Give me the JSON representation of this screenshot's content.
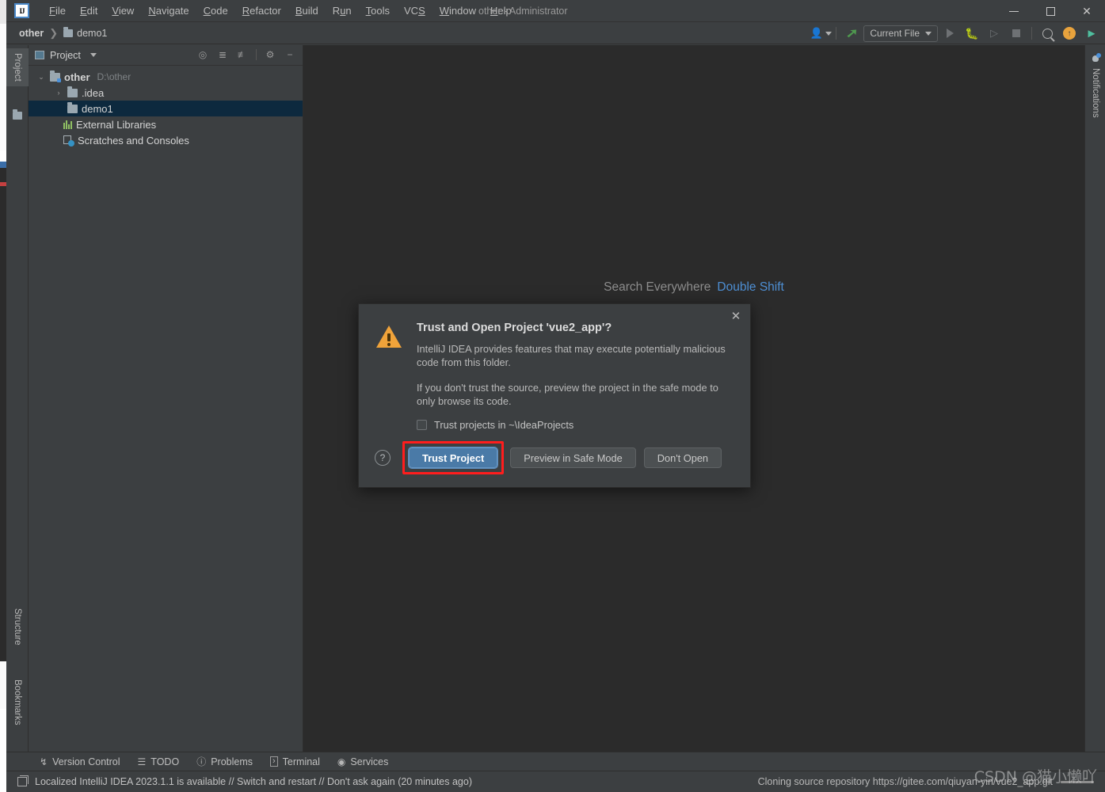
{
  "window": {
    "title": "other - Administrator",
    "logo_text": "IJ",
    "controls": {
      "minimize": "minimize",
      "maximize": "maximize",
      "close": "✕"
    }
  },
  "menubar": {
    "items": [
      {
        "label": "File"
      },
      {
        "label": "Edit"
      },
      {
        "label": "View"
      },
      {
        "label": "Navigate"
      },
      {
        "label": "Code"
      },
      {
        "label": "Refactor"
      },
      {
        "label": "Build"
      },
      {
        "label": "Run"
      },
      {
        "label": "Tools"
      },
      {
        "label": "VCS"
      },
      {
        "label": "Window"
      },
      {
        "label": "Help"
      }
    ]
  },
  "navbar": {
    "crumb_root": "other",
    "crumb_sep": "❯",
    "crumb_child": "demo1",
    "run_config": "Current File"
  },
  "left_strip": {
    "tabs": [
      {
        "label": "Project",
        "active": true
      },
      {
        "label": "Structure",
        "active": false
      },
      {
        "label": "Bookmarks",
        "active": false
      }
    ]
  },
  "right_strip": {
    "notifications_label": "Notifications"
  },
  "project_panel": {
    "title": "Project",
    "tree": [
      {
        "label": "other",
        "path": "D:\\other",
        "depth": 0,
        "arrow": "⌄",
        "icon": "module-folder-icon",
        "bold": true,
        "selected": false
      },
      {
        "label": ".idea",
        "path": "",
        "depth": 1,
        "arrow": "›",
        "icon": "folder-icon",
        "bold": false,
        "selected": false
      },
      {
        "label": "demo1",
        "path": "",
        "depth": 1,
        "arrow": "",
        "icon": "folder-icon",
        "bold": false,
        "selected": true
      },
      {
        "label": "External Libraries",
        "path": "",
        "depth": 0,
        "arrow": "",
        "icon": "library-icon",
        "bold": false,
        "selected": false
      },
      {
        "label": "Scratches and Consoles",
        "path": "",
        "depth": 0,
        "arrow": "",
        "icon": "scratches-icon",
        "bold": false,
        "selected": false
      }
    ]
  },
  "editor": {
    "hint_text": "Search Everywhere",
    "hint_shortcut": "Double Shift"
  },
  "dialog": {
    "title": "Trust and Open Project 'vue2_app'?",
    "paragraph1": "IntelliJ IDEA provides features that may execute potentially malicious code from this folder.",
    "paragraph2": "If you don't trust the source, preview the project in the safe mode to only browse its code.",
    "checkbox_label": "Trust projects in ~\\IdeaProjects",
    "checkbox_checked": false,
    "help_label": "?",
    "close_label": "✕",
    "buttons": [
      {
        "label": "Trust Project",
        "primary": true,
        "highlighted": true
      },
      {
        "label": "Preview in Safe Mode",
        "primary": false,
        "highlighted": false
      },
      {
        "label": "Don't Open",
        "primary": false,
        "highlighted": false
      }
    ],
    "highlight_color": "#ff1d1d"
  },
  "bottom_bar": {
    "tools": [
      {
        "label": "Version Control",
        "icon": "branch-icon"
      },
      {
        "label": "TODO",
        "icon": "list-icon"
      },
      {
        "label": "Problems",
        "icon": "warning-circle-icon"
      },
      {
        "label": "Terminal",
        "icon": "terminal-icon"
      },
      {
        "label": "Services",
        "icon": "play-circle-icon"
      }
    ]
  },
  "status_bar": {
    "message": "Localized IntelliJ IDEA 2023.1.1 is available // Switch and restart // Don't ask again (20 minutes ago)",
    "clone_message": "Cloning source repository https://gitee.com/qiuyan-yin/vue2_app.git"
  },
  "watermark": {
    "text": "CSDN @猫小懒吖"
  },
  "colors": {
    "frame_bg": "#3c3f41",
    "editor_bg": "#2b2b2b",
    "selection_bg": "#0d293e",
    "accent_blue": "#4e8fd4",
    "primary_btn": "#4a7aa7",
    "warning_orange": "#f0a33a",
    "highlight_red": "#ff1d1d"
  }
}
